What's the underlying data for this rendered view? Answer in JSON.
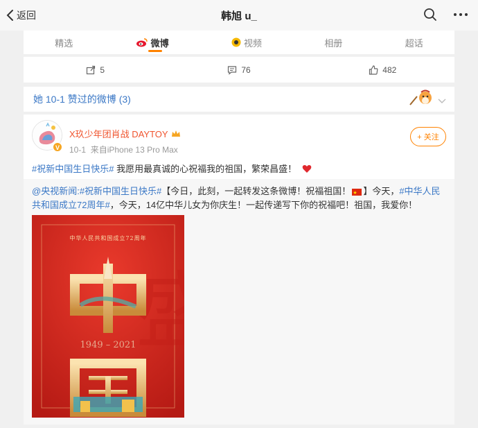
{
  "nav": {
    "back_label": "返回",
    "title": "韩旭 u_"
  },
  "tabs": [
    {
      "label": "精选",
      "active": false,
      "icon": "none"
    },
    {
      "label": "微博",
      "active": true,
      "icon": "weibo-icon"
    },
    {
      "label": "视频",
      "active": false,
      "icon": "video-icon"
    },
    {
      "label": "相册",
      "active": false,
      "icon": "none"
    },
    {
      "label": "超话",
      "active": false,
      "icon": "none"
    }
  ],
  "stats": {
    "repost_count": "5",
    "comment_count": "76",
    "like_count": "482"
  },
  "liked_section": {
    "title": "她 10-1 赞过的微博 (3)"
  },
  "post": {
    "username": "X玖少年团肖战 DAYTOY",
    "verified_badge": "V",
    "date": "10-1",
    "source": "来自iPhone 13 Pro Max",
    "follow_label": "+ 关注",
    "hashtag": "#祝新中国生日快乐#",
    "text": " 我愿用最真诚的心祝福我的祖国，繁荣昌盛！",
    "repost": {
      "author": "@央视新闻",
      "colon": ":",
      "hashtag1": "#祝新中国生日快乐#",
      "text1": "【今日，此刻，一起转发这条微博！祝福祖国！",
      "text2": "】今天，",
      "hashtag2": "#中华人民共和国成立72周年#",
      "text3": "，今天，14亿中华儿女为你庆生！一起传递写下你的祝福吧！祖国，我爱你！",
      "poster": {
        "header_text": "中华人民共和国成立72周年",
        "big_char_1": "中",
        "big_char_2": "国",
        "years": "1949 – 2021"
      }
    }
  },
  "colors": {
    "accent": "#ff8200",
    "link": "#3b78c6",
    "username": "#f0542e",
    "poster_red": "#d7241d"
  }
}
